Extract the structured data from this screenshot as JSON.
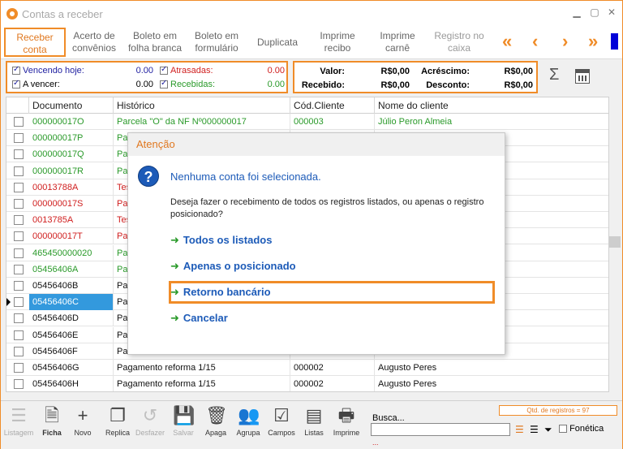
{
  "window": {
    "title": "Contas a receber"
  },
  "tabs": [
    {
      "label_lines": [
        "Receber",
        "conta"
      ],
      "active": true
    },
    {
      "label_lines": [
        "Acerto de",
        "convênios"
      ]
    },
    {
      "label_lines": [
        "Boleto em",
        "folha branca"
      ]
    },
    {
      "label_lines": [
        "Boleto em",
        "formulário"
      ]
    },
    {
      "label_lines": [
        "Duplicata"
      ]
    },
    {
      "label_lines": [
        "Imprime",
        "recibo"
      ]
    },
    {
      "label_lines": [
        "Imprime",
        "carnê"
      ]
    },
    {
      "label_lines": [
        "Registro no",
        "caixa"
      ],
      "disabled": true
    }
  ],
  "filters": {
    "vencendo_hoje": {
      "label": "Vencendo hoje:",
      "value": "0.00"
    },
    "a_vencer": {
      "label": "A vencer:",
      "value": "0.00"
    },
    "atrasadas": {
      "label": "Atrasadas:",
      "value": "0.00"
    },
    "recebidas": {
      "label": "Recebidas:",
      "value": "0.00"
    }
  },
  "totals": {
    "valor": {
      "label": "Valor:",
      "value": "R$0,00"
    },
    "recebido": {
      "label": "Recebido:",
      "value": "R$0,00"
    },
    "acrescimo": {
      "label": "Acréscimo:",
      "value": "R$0,00"
    },
    "desconto": {
      "label": "Desconto:",
      "value": "R$0,00"
    }
  },
  "grid": {
    "columns": [
      "Documento",
      "Histórico",
      "Cód.Cliente",
      "Nome do cliente"
    ],
    "rows": [
      {
        "doc": "000000017O",
        "hist": "Parcela \"O\" da NF Nº000000017",
        "cod": "000003",
        "nome": "Júlio Peron Almeia",
        "color": "green"
      },
      {
        "doc": "000000017P",
        "hist": "Pa",
        "cod": "",
        "nome": "",
        "color": "green"
      },
      {
        "doc": "000000017Q",
        "hist": "Pa",
        "cod": "",
        "nome": "",
        "color": "green"
      },
      {
        "doc": "000000017R",
        "hist": "Pa",
        "cod": "",
        "nome": "",
        "color": "green"
      },
      {
        "doc": "00013788A",
        "hist": "Tes",
        "cod": "",
        "nome": "",
        "color": "red"
      },
      {
        "doc": "000000017S",
        "hist": "Pa",
        "cod": "",
        "nome": "",
        "color": "red"
      },
      {
        "doc": "0013785A",
        "hist": "Tes",
        "cod": "",
        "nome": "",
        "color": "red"
      },
      {
        "doc": "000000017T",
        "hist": "Pa",
        "cod": "",
        "nome": "",
        "color": "red"
      },
      {
        "doc": "465450000020",
        "hist": "Pa",
        "cod": "",
        "nome": "",
        "color": "green"
      },
      {
        "doc": "05456406A",
        "hist": "Pa",
        "cod": "",
        "nome": "",
        "color": "green"
      },
      {
        "doc": "05456406B",
        "hist": "Pa",
        "cod": "",
        "nome": "",
        "color": "black"
      },
      {
        "doc": "05456406C",
        "hist": "Pa",
        "cod": "",
        "nome": "",
        "color": "black",
        "selected": true
      },
      {
        "doc": "05456406D",
        "hist": "Pa",
        "cod": "",
        "nome": "",
        "color": "black"
      },
      {
        "doc": "05456406E",
        "hist": "Pa",
        "cod": "",
        "nome": "",
        "color": "black"
      },
      {
        "doc": "05456406F",
        "hist": "Pa",
        "cod": "",
        "nome": "",
        "color": "black"
      },
      {
        "doc": "05456406G",
        "hist": "Pagamento reforma 1/15",
        "cod": "000002",
        "nome": "Augusto Peres",
        "color": "black"
      },
      {
        "doc": "05456406H",
        "hist": "Pagamento reforma 1/15",
        "cod": "000002",
        "nome": "Augusto Peres",
        "color": "black"
      }
    ]
  },
  "dialog": {
    "title": "Atenção",
    "message": "Nenhuma conta foi selecionada.",
    "description": "Deseja fazer o recebimento de todos os registros listados, ou apenas o registro posicionado?",
    "options": [
      {
        "label": "Todos os listados"
      },
      {
        "label": "Apenas o posicionado"
      },
      {
        "label": "Retorno bancário",
        "highlighted": true
      },
      {
        "label": "Cancelar"
      }
    ]
  },
  "bottom": {
    "buttons": [
      {
        "label": "Listagem",
        "icon": "list-icon",
        "disabled": true
      },
      {
        "label": "Ficha",
        "icon": "document-icon"
      },
      {
        "label": "Novo",
        "icon": "plus-icon"
      },
      {
        "label": "Replica",
        "icon": "copy-icon"
      },
      {
        "label": "Desfazer",
        "icon": "undo-icon",
        "disabled": true
      },
      {
        "label": "Salvar",
        "icon": "save-icon",
        "disabled": true
      },
      {
        "label": "Apaga",
        "icon": "trash-icon"
      },
      {
        "label": "Agrupa",
        "icon": "group-icon"
      },
      {
        "label": "Campos",
        "icon": "checklist-icon"
      },
      {
        "label": "Listas",
        "icon": "lists-icon"
      },
      {
        "label": "Imprime",
        "icon": "printer-icon"
      }
    ],
    "search_label": "Busca...",
    "search_value": "",
    "qtd_registros": "Qtd. de registros = 97",
    "fonetica_label": "Fonética",
    "dots": "..."
  }
}
